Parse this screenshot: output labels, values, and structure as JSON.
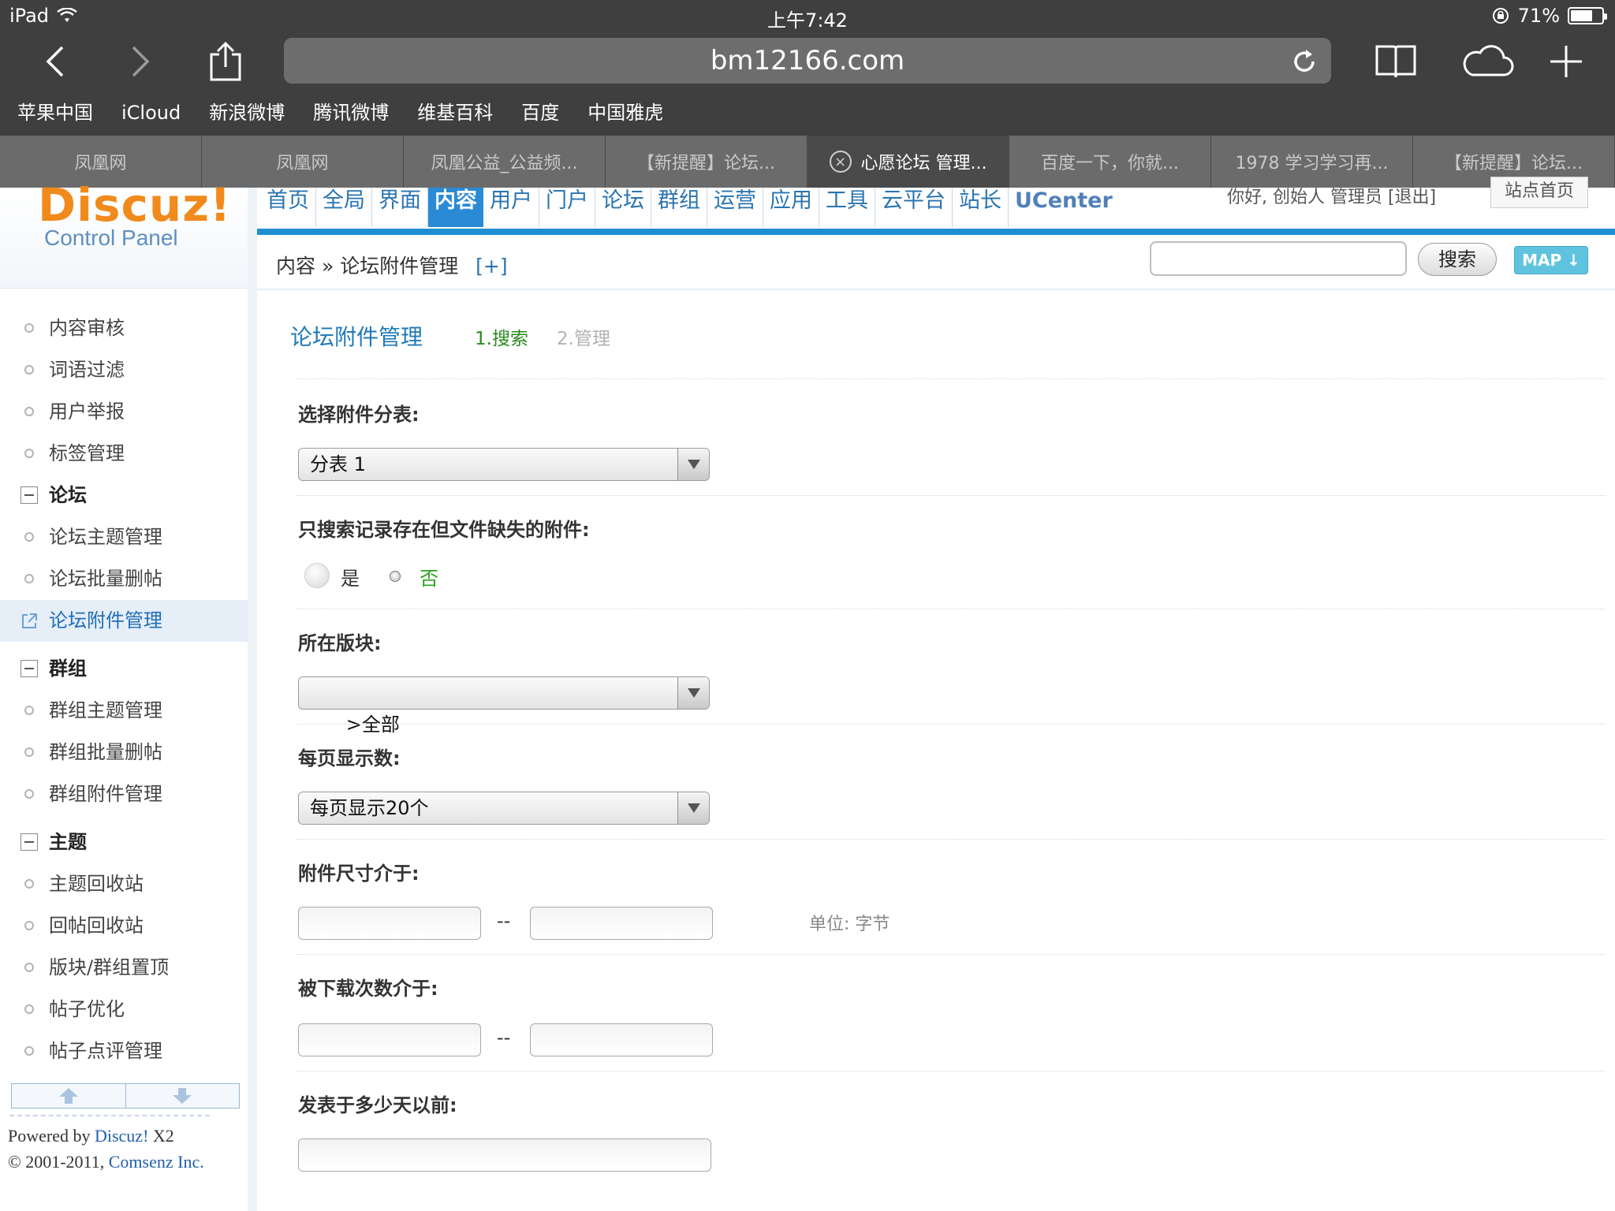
{
  "status_bar": {
    "device": "iPad",
    "time": "上午7:42",
    "battery": "71%",
    "battery_level": 0.71
  },
  "browser": {
    "url": "bm12166.com",
    "bookmarks": [
      "苹果中国",
      "iCloud",
      "新浪微博",
      "腾讯微博",
      "维基百科",
      "百度",
      "中国雅虎"
    ],
    "tabs": [
      {
        "label": "凤凰网",
        "active": false
      },
      {
        "label": "凤凰网",
        "active": false
      },
      {
        "label": "凤凰公益_公益频...",
        "active": false
      },
      {
        "label": "【新提醒】论坛...",
        "active": false
      },
      {
        "label": "心愿论坛 管理...",
        "active": true
      },
      {
        "label": "百度一下，你就...",
        "active": false
      },
      {
        "label": "1978 学习学习再...",
        "active": false
      },
      {
        "label": "【新提醒】论坛...",
        "active": false
      }
    ]
  },
  "header": {
    "logo_text": "Discuz!",
    "logo_sub": "Control Panel",
    "nav": [
      "首页",
      "全局",
      "界面",
      "内容",
      "用户",
      "门户",
      "论坛",
      "群组",
      "运营",
      "应用",
      "工具",
      "云平台",
      "站长",
      "UCenter"
    ],
    "nav_selected": "内容",
    "greeting": "你好, 创始人 管理员 [退出]",
    "home_link": "站点首页",
    "breadcrumb": "内容 » 论坛附件管理",
    "breadcrumb_plus": "[+]",
    "search_button": "搜索",
    "map_button": "MAP"
  },
  "sidebar": {
    "items": [
      {
        "label": "内容审核",
        "type": "item"
      },
      {
        "label": "词语过滤",
        "type": "item"
      },
      {
        "label": "用户举报",
        "type": "item"
      },
      {
        "label": "标签管理",
        "type": "item"
      },
      {
        "label": "论坛",
        "type": "group"
      },
      {
        "label": "论坛主题管理",
        "type": "item"
      },
      {
        "label": "论坛批量删帖",
        "type": "item"
      },
      {
        "label": "论坛附件管理",
        "type": "current"
      },
      {
        "label": "群组",
        "type": "group"
      },
      {
        "label": "群组主题管理",
        "type": "item"
      },
      {
        "label": "群组批量删帖",
        "type": "item"
      },
      {
        "label": "群组附件管理",
        "type": "item"
      },
      {
        "label": "主题",
        "type": "group"
      },
      {
        "label": "主题回收站",
        "type": "item"
      },
      {
        "label": "回帖回收站",
        "type": "item"
      },
      {
        "label": "版块/群组置顶",
        "type": "item"
      },
      {
        "label": "帖子优化",
        "type": "item"
      },
      {
        "label": "帖子点评管理",
        "type": "item"
      }
    ],
    "powered_prefix": "Powered by ",
    "powered_link": "Discuz!",
    "powered_version": " X2",
    "copyright_prefix": "© 2001-2011, ",
    "copyright_link": "Comsenz Inc."
  },
  "main": {
    "title": "论坛附件管理",
    "step1": "1.搜索",
    "step2": "2.管理",
    "f_table_label": "选择附件分表:",
    "f_table_value": "分表 1",
    "f_missing_label": "只搜索记录存在但文件缺失的附件:",
    "f_missing_yes": "是",
    "f_missing_no": "否",
    "f_forum_label": "所在版块:",
    "f_forum_value": "  >全部",
    "f_perpage_label": "每页显示数:",
    "f_perpage_value": "每页显示20个",
    "f_size_label": "附件尺寸介于:",
    "f_size_sep": "--",
    "f_size_unit": "单位: 字节",
    "f_downloads_label": "被下载次数介于:",
    "f_downloads_sep": "--",
    "f_days_label": "发表于多少天以前:"
  },
  "colors": {
    "accent_blue": "#1f8fd2",
    "logo_orange": "#f18a1c",
    "step_green": "#2a8a1e"
  }
}
